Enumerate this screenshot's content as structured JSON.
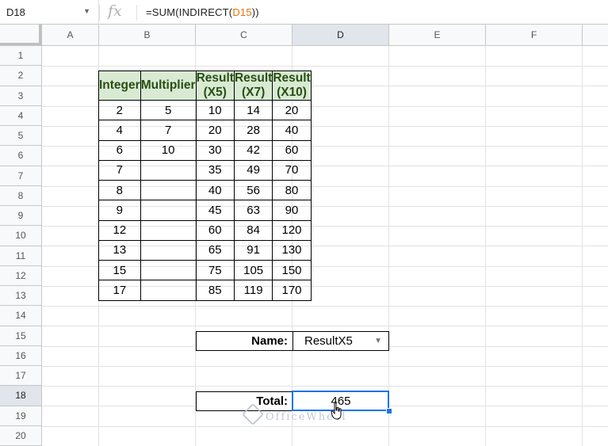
{
  "formula_bar": {
    "cell_ref": "D18",
    "fx_label": "fx",
    "formula_prefix": "=SUM(INDIRECT(",
    "formula_ref": "D15",
    "formula_suffix": "))"
  },
  "columns": [
    "A",
    "B",
    "C",
    "D",
    "E",
    "F"
  ],
  "selected_column": "D",
  "rows": [
    "1",
    "2",
    "3",
    "4",
    "5",
    "6",
    "7",
    "8",
    "9",
    "10",
    "11",
    "12",
    "13",
    "14",
    "15",
    "16",
    "17",
    "18",
    "19",
    "20"
  ],
  "selected_row": "18",
  "table": {
    "headers": [
      "Integer",
      "Multiplier",
      "Result (X5)",
      "Result (X7)",
      "Result (X10)"
    ],
    "rows": [
      [
        "2",
        "5",
        "10",
        "14",
        "20"
      ],
      [
        "4",
        "7",
        "20",
        "28",
        "40"
      ],
      [
        "6",
        "10",
        "30",
        "42",
        "60"
      ],
      [
        "7",
        "",
        "35",
        "49",
        "70"
      ],
      [
        "8",
        "",
        "40",
        "56",
        "80"
      ],
      [
        "9",
        "",
        "45",
        "63",
        "90"
      ],
      [
        "12",
        "",
        "60",
        "84",
        "120"
      ],
      [
        "13",
        "",
        "65",
        "91",
        "130"
      ],
      [
        "15",
        "",
        "75",
        "105",
        "150"
      ],
      [
        "17",
        "",
        "85",
        "119",
        "170"
      ]
    ]
  },
  "name_field": {
    "label": "Name:",
    "value": "ResultX5"
  },
  "total_field": {
    "label": "Total:",
    "value": "465"
  },
  "watermark": "OfficeWheel",
  "colors": {
    "header_fill": "#d9ead3",
    "header_text": "#274e13",
    "selection": "#1a73e8"
  }
}
